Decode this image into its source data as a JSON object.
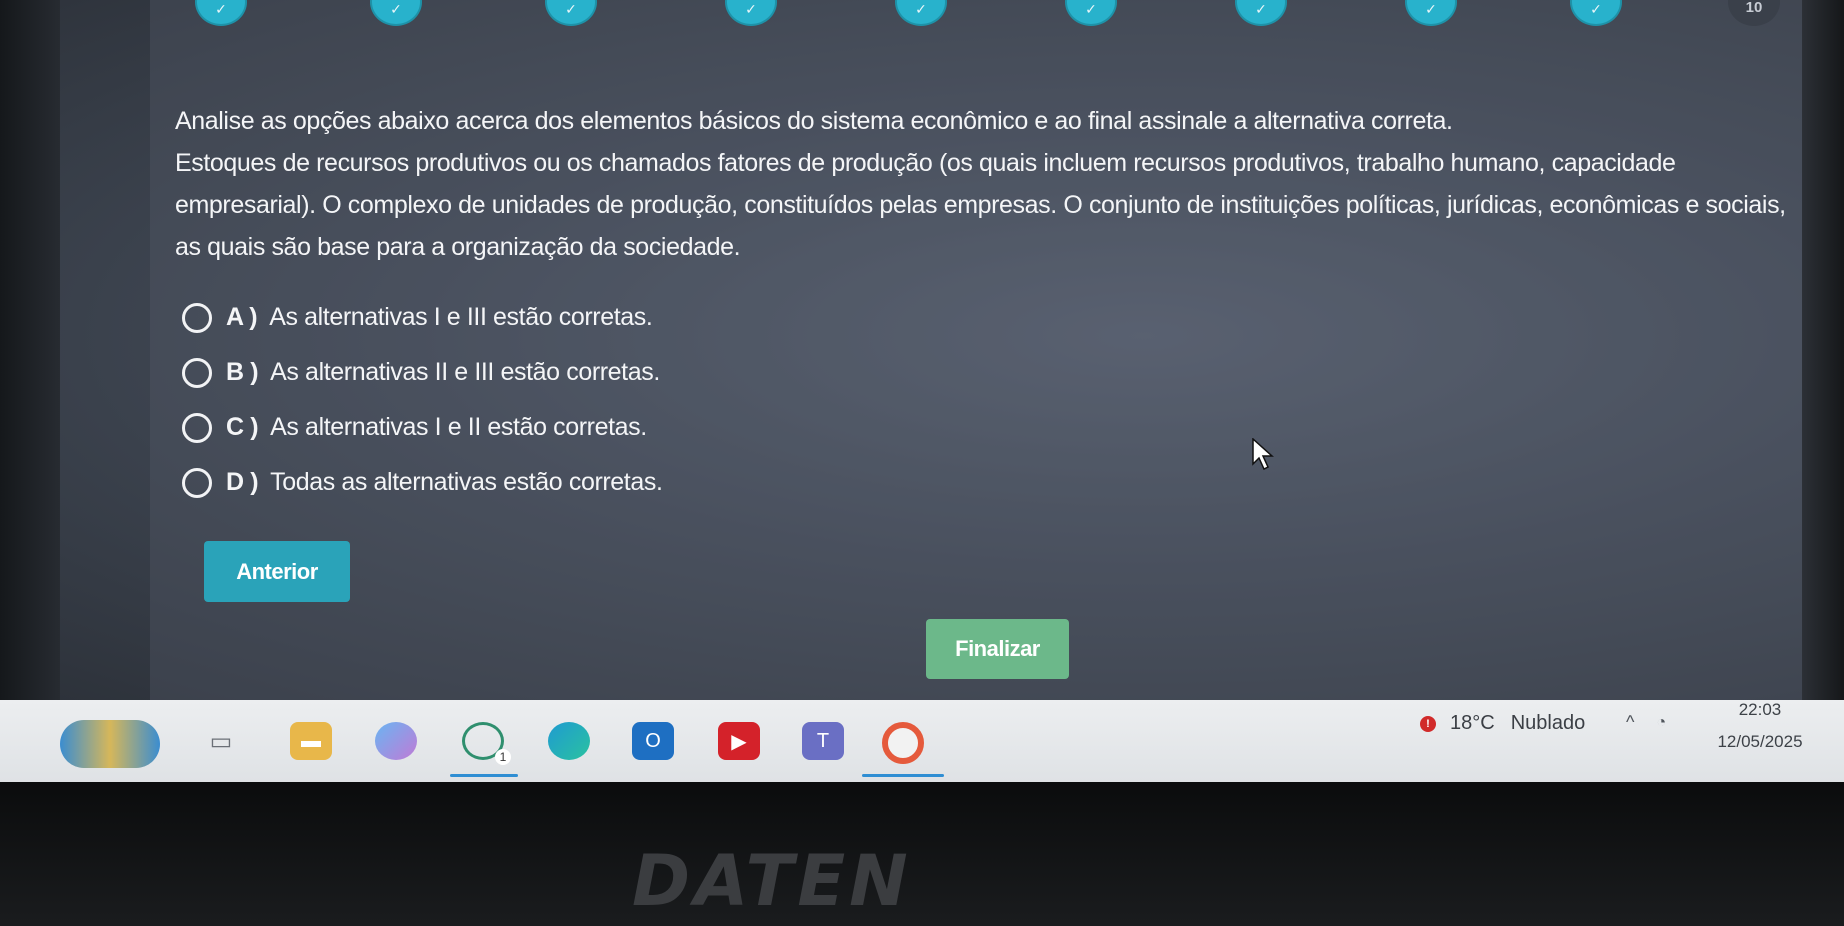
{
  "progress": {
    "steps": [
      {
        "mark": "✓"
      },
      {
        "mark": "✓"
      },
      {
        "mark": "✓"
      },
      {
        "mark": "✓"
      },
      {
        "mark": "✓"
      },
      {
        "mark": "✓"
      },
      {
        "mark": "✓"
      },
      {
        "mark": "✓"
      },
      {
        "mark": "✓"
      },
      {
        "mark": "10"
      }
    ]
  },
  "question": {
    "intro": "Analise as opções abaixo acerca dos elementos básicos do sistema econômico e ao final assinale a alternativa correta.",
    "body": "Estoques de recursos produtivos ou os chamados fatores de produção (os quais incluem recursos produtivos, trabalho humano, capacidade empresarial). O complexo de unidades de produção, constituídos pelas empresas. O conjunto de instituições políticas, jurídicas, econômicas e sociais, as quais são base para a organização da sociedade."
  },
  "options": [
    {
      "letter": "A )",
      "text": "As alternativas I e III estão corretas."
    },
    {
      "letter": "B )",
      "text": "As alternativas II e III estão corretas."
    },
    {
      "letter": "C )",
      "text": "As alternativas I e II estão corretas."
    },
    {
      "letter": "D )",
      "text": "Todas as alternativas estão corretas."
    }
  ],
  "buttons": {
    "previous": "Anterior",
    "finish": "Finalizar"
  },
  "taskbar": {
    "chat_badge": "1",
    "weather_alert": "!",
    "temperature": "18°C",
    "condition": "Nublado",
    "time": "22:03",
    "date": "12/05/2025"
  },
  "device": {
    "brand": "DATEN"
  },
  "colors": {
    "step_done": "#28b2cc",
    "button_previous": "#2aa3b9",
    "button_finish": "#6cb88a"
  }
}
